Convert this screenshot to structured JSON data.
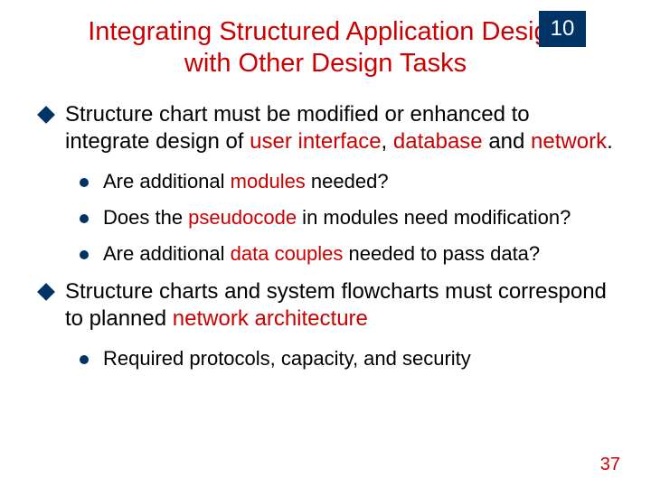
{
  "chapter": "10",
  "title": "Integrating Structured Application Design with Other Design Tasks",
  "b1a": {
    "pre": "Structure chart must be modified or enhanced to integrate design of ",
    "h1": "user interface",
    "mid1": ", ",
    "h2": "database",
    "mid2": " and ",
    "h3": "network",
    "post": "."
  },
  "b2a": {
    "pre": "Are additional ",
    "h1": "modules",
    "post": " needed?"
  },
  "b2b": {
    "pre": "Does the ",
    "h1": "pseudocode",
    "post": " in  modules need modification?"
  },
  "b2c": {
    "pre": "Are additional ",
    "h1": "data couples",
    "post": " needed to pass data?"
  },
  "b1b": {
    "pre": "Structure charts and system flowcharts must correspond to planned ",
    "h1": "network architecture",
    "post": ""
  },
  "b2d": {
    "pre": "Required protocols, capacity, and security",
    "h1": "",
    "post": ""
  },
  "pagenum": "37"
}
